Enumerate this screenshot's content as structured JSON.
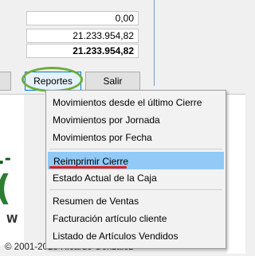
{
  "totals": {
    "row1": "0,00",
    "row2": "21.233.954,82",
    "row3": "21.233.954,82"
  },
  "buttons": {
    "reportes": "Reportes",
    "salir": "Salir"
  },
  "menu": {
    "items": [
      "Movimientos desde el último Cierre",
      "Movimientos por Jornada",
      "Movimientos por Fecha",
      "Reimprimir Cierre",
      "Estado Actual de la Caja",
      "Resumen de Ventas",
      "Facturación artículo cliente",
      "Listado de Artículos Vendidos"
    ],
    "highlighted_index": 3
  },
  "footer": {
    "copyright": "© 2001-2018 Ricardo González"
  },
  "colors": {
    "highlight": "#91c9f7",
    "annotation_circle": "#6cae3a",
    "annotation_underline": "#e02020"
  }
}
